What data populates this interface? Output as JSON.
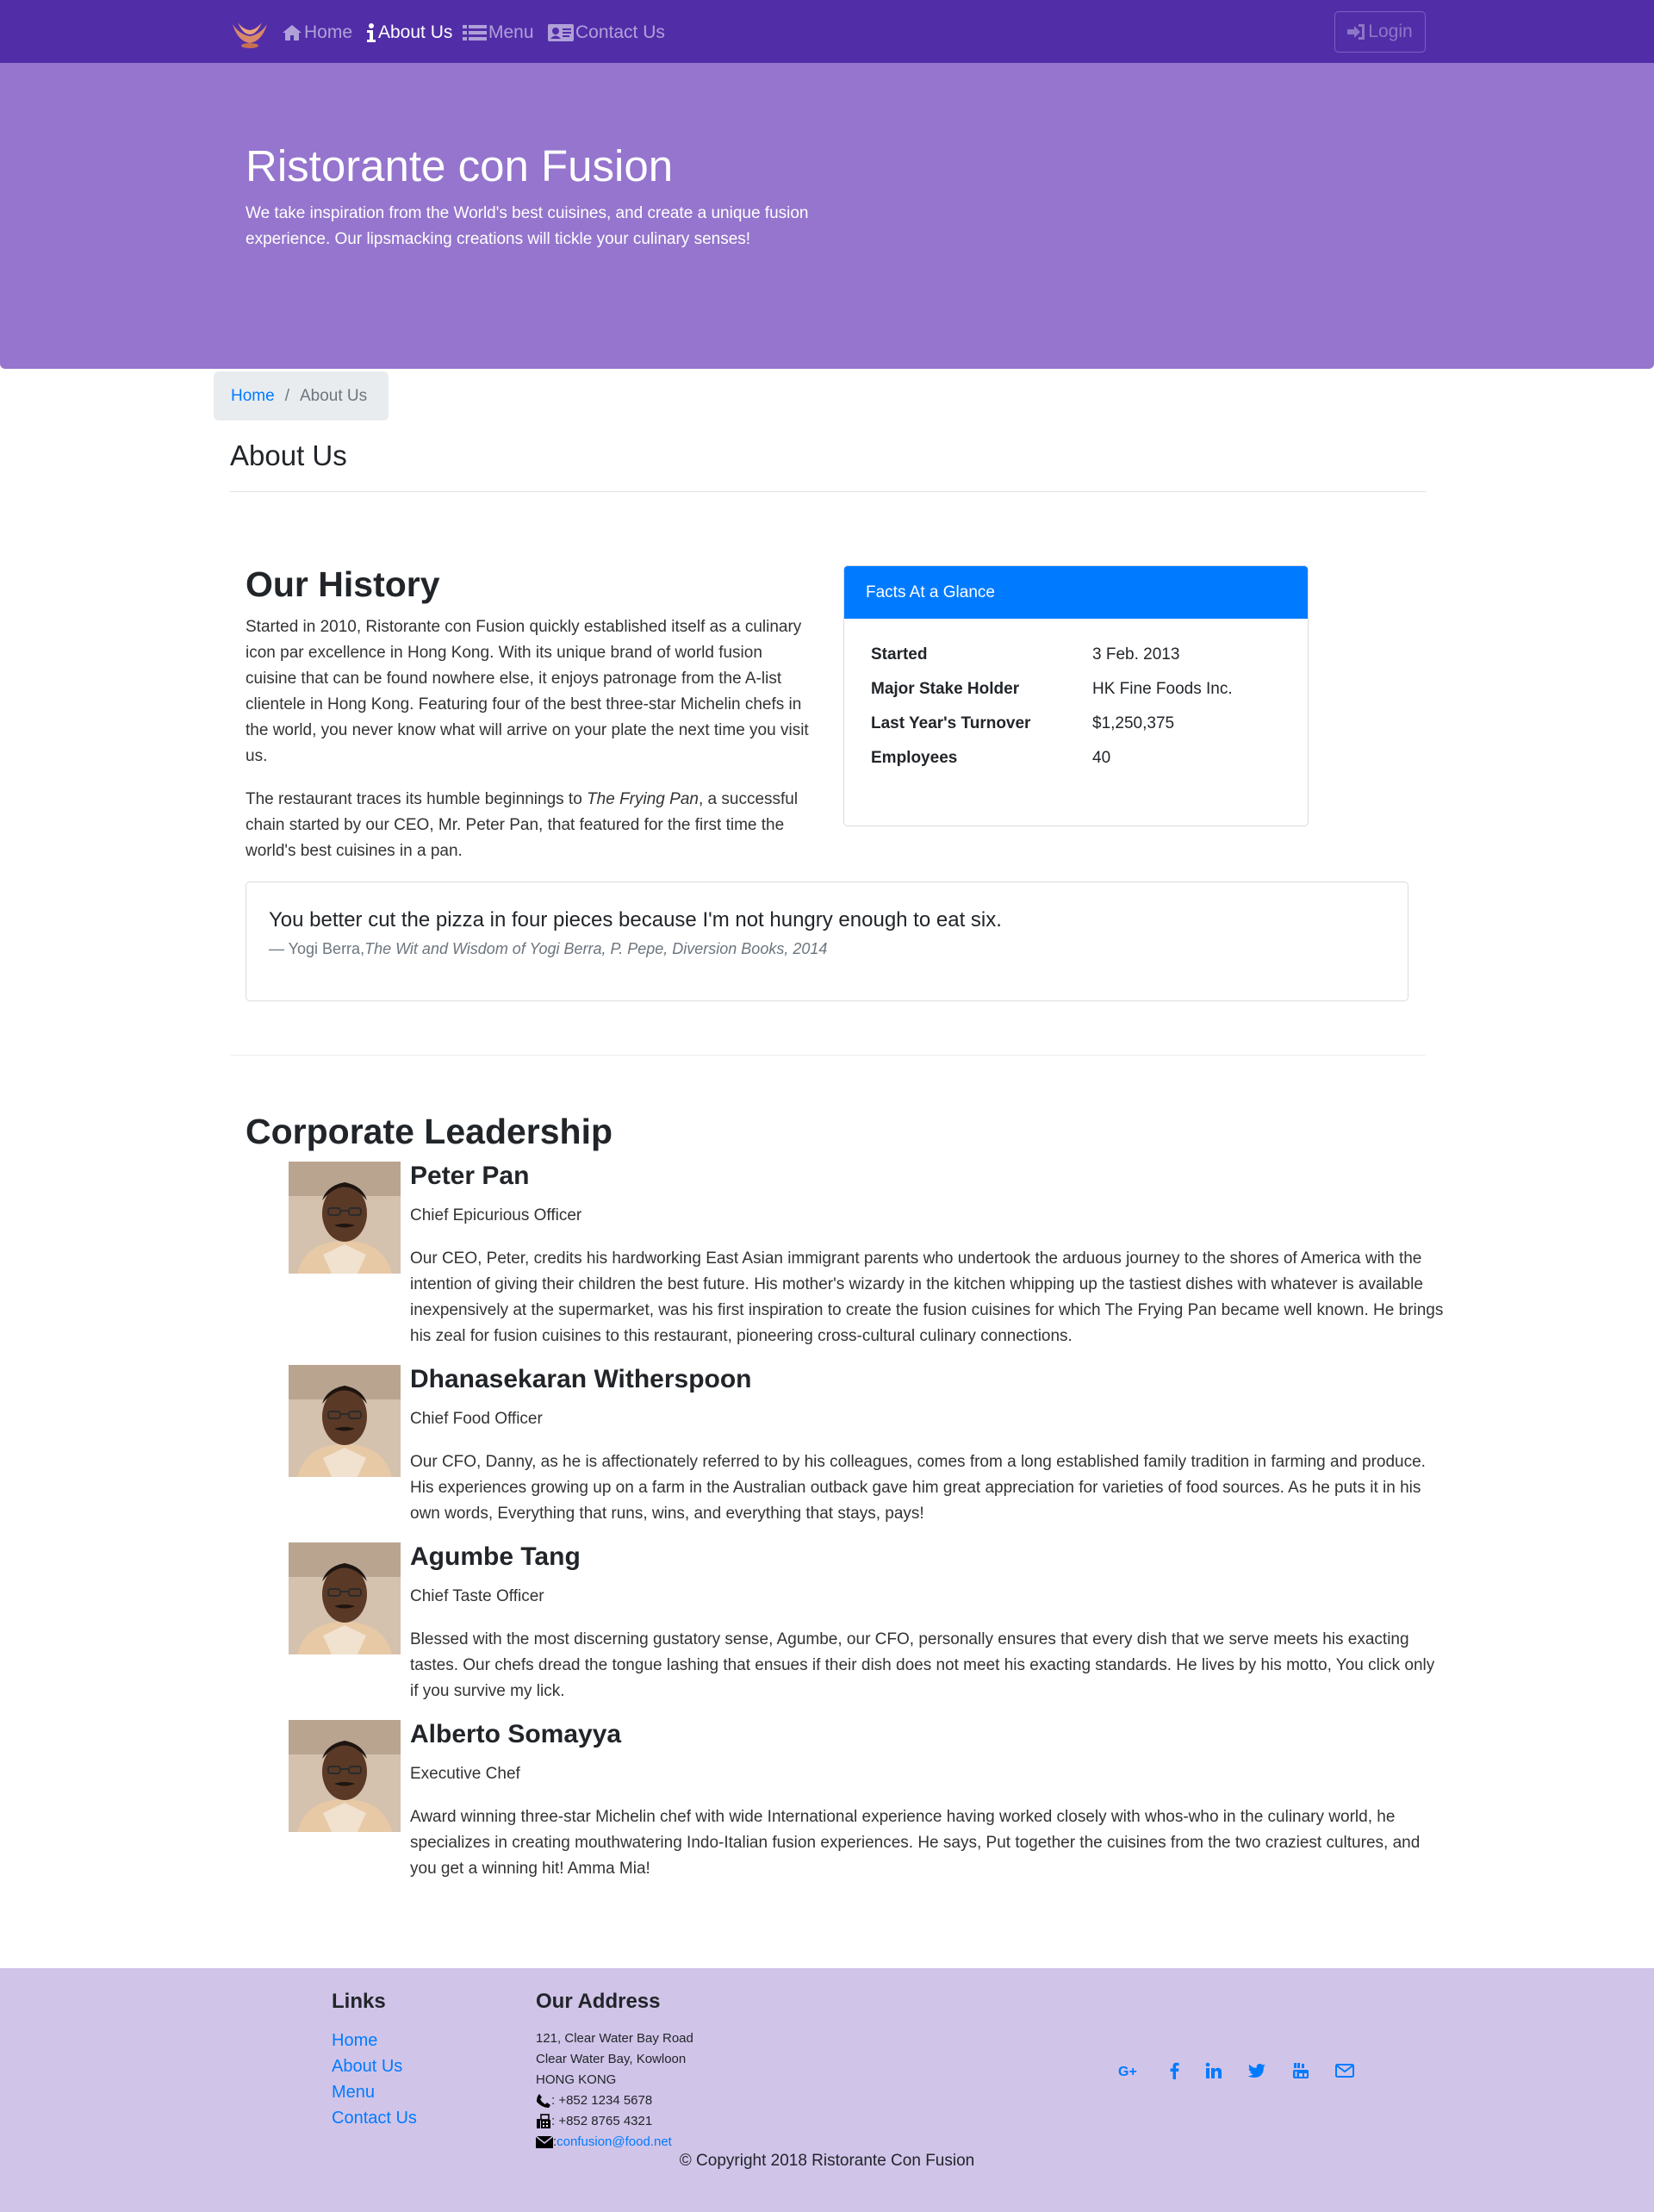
{
  "navbar": {
    "items": [
      {
        "label": "Home",
        "icon": "home-icon",
        "active": false
      },
      {
        "label": "About Us",
        "icon": "info-icon",
        "active": true
      },
      {
        "label": "Menu",
        "icon": "list-icon",
        "active": false
      },
      {
        "label": "Contact Us",
        "icon": "address-card-icon",
        "active": false
      }
    ],
    "login_label": "Login"
  },
  "jumbotron": {
    "title": "Ristorante con Fusion",
    "text": "We take inspiration from the World's best cuisines, and create a unique fusion experience. Our lipsmacking creations will tickle your culinary senses!"
  },
  "breadcrumb": {
    "home": "Home",
    "separator": "/",
    "current": "About Us"
  },
  "page": {
    "heading": "About Us"
  },
  "history": {
    "title": "Our History",
    "p1": "Started in 2010, Ristorante con Fusion quickly established itself as a culinary icon par excellence in Hong Kong. With its unique brand of world fusion cuisine that can be found nowhere else, it enjoys patronage from the A-list clientele in Hong Kong. Featuring four of the best three-star Michelin chefs in the world, you never know what will arrive on your plate the next time you visit us.",
    "p2_before": "The restaurant traces its humble beginnings to ",
    "p2_italic": "The Frying Pan",
    "p2_after": ", a successful chain started by our CEO, Mr. Peter Pan, that featured for the first time the world's best cuisines in a pan."
  },
  "facts": {
    "header": "Facts At a Glance",
    "rows": [
      {
        "label": "Started",
        "value": "3 Feb. 2013"
      },
      {
        "label": "Major Stake Holder",
        "value": "HK Fine Foods Inc."
      },
      {
        "label": "Last Year's Turnover",
        "value": "$1,250,375"
      },
      {
        "label": "Employees",
        "value": "40"
      }
    ]
  },
  "quote": {
    "text": "You better cut the pizza in four pieces because I'm not hungry enough to eat six.",
    "author": "— Yogi Berra,",
    "source": "The Wit and Wisdom of Yogi Berra, P. Pepe, Diversion Books, 2014"
  },
  "leadership": {
    "title": "Corporate Leadership",
    "leaders": [
      {
        "name": "Peter Pan",
        "role": "Chief Epicurious Officer",
        "description": "Our CEO, Peter, credits his hardworking East Asian immigrant parents who undertook the arduous journey to the shores of America with the intention of giving their children the best future. His mother's wizardy in the kitchen whipping up the tastiest dishes with whatever is available inexpensively at the supermarket, was his first inspiration to create the fusion cuisines for which The Frying Pan became well known. He brings his zeal for fusion cuisines to this restaurant, pioneering cross-cultural culinary connections."
      },
      {
        "name": "Dhanasekaran Witherspoon",
        "role": "Chief Food Officer",
        "description": "Our CFO, Danny, as he is affectionately referred to by his colleagues, comes from a long established family tradition in farming and produce. His experiences growing up on a farm in the Australian outback gave him great appreciation for varieties of food sources. As he puts it in his own words, Everything that runs, wins, and everything that stays, pays!"
      },
      {
        "name": "Agumbe Tang",
        "role": "Chief Taste Officer",
        "description": "Blessed with the most discerning gustatory sense, Agumbe, our CFO, personally ensures that every dish that we serve meets his exacting tastes. Our chefs dread the tongue lashing that ensues if their dish does not meet his exacting standards. He lives by his motto, You click only if you survive my lick."
      },
      {
        "name": "Alberto Somayya",
        "role": "Executive Chef",
        "description": "Award winning three-star Michelin chef with wide International experience having worked closely with whos-who in the culinary world, he specializes in creating mouthwatering Indo-Italian fusion experiences. He says, Put together the cuisines from the two craziest cultures, and you get a winning hit! Amma Mia!"
      }
    ]
  },
  "footer": {
    "links_heading": "Links",
    "links": [
      "Home",
      "About Us",
      "Menu",
      "Contact Us"
    ],
    "address_heading": "Our Address",
    "address": [
      "121, Clear Water Bay Road",
      "Clear Water Bay, Kowloon",
      "HONG KONG"
    ],
    "phone": ": +852 1234 5678",
    "fax": ": +852 8765 4321",
    "email": "confusion@food.net",
    "email_prefix": ":",
    "social": [
      "google-plus-icon",
      "facebook-icon",
      "linkedin-icon",
      "twitter-icon",
      "youtube-icon",
      "mail-icon"
    ],
    "copyright": "© Copyright 2018 Ristorante Con Fusion"
  },
  "colors": {
    "navbar": "#512da8",
    "jumbotron": "#9575cd",
    "footer": "#d1c4e9",
    "card_header": "#007bff",
    "link": "#007bff"
  }
}
